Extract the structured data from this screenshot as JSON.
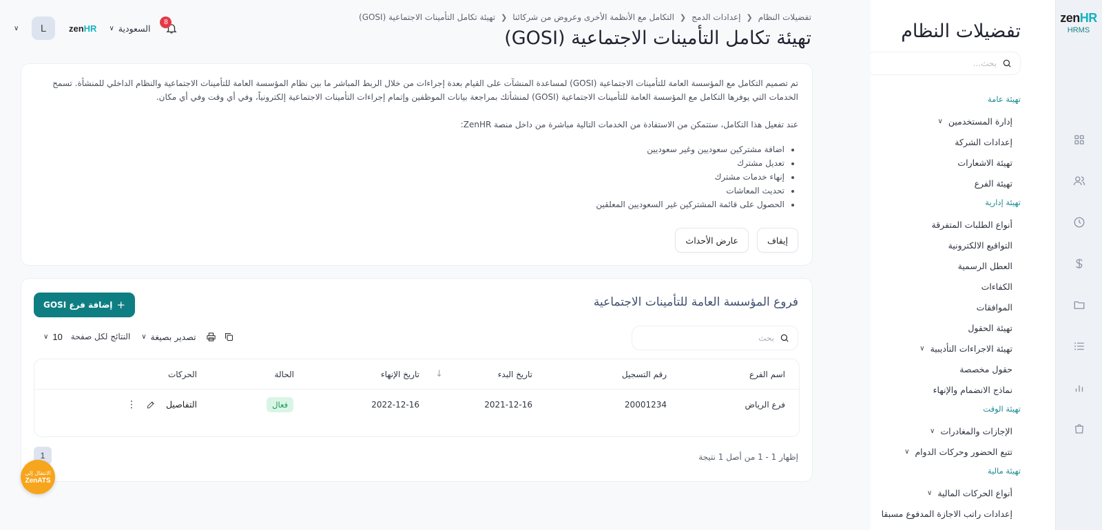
{
  "rail": {
    "brand": "zen",
    "brand_accent": "HR",
    "product": "HRMS",
    "icons": [
      "grid-icon",
      "users-icon",
      "clock-icon",
      "dollar-icon",
      "folder-icon",
      "list-icon",
      "bar-chart-icon",
      "bag-icon"
    ]
  },
  "sidebar": {
    "title": "تفضيلات النظام",
    "search_placeholder": "بحث...",
    "entries": [
      {
        "type": "section",
        "label": "تهيئة عامة"
      },
      {
        "type": "item",
        "label": "إدارة المستخدمين",
        "expandable": true
      },
      {
        "type": "item",
        "label": "إعدادات الشركة"
      },
      {
        "type": "item",
        "label": "تهيئة الاشعارات"
      },
      {
        "type": "item",
        "label": "تهيئة الفرع"
      },
      {
        "type": "section",
        "label": "تهيئة إدارية"
      },
      {
        "type": "item",
        "label": "أنواع الطلبات المتفرقة"
      },
      {
        "type": "item",
        "label": "التواقيع الالكترونية"
      },
      {
        "type": "item",
        "label": "العطل الرسمية"
      },
      {
        "type": "item",
        "label": "الكفاءات"
      },
      {
        "type": "item",
        "label": "الموافقات"
      },
      {
        "type": "item",
        "label": "تهيئة الحقول"
      },
      {
        "type": "item",
        "label": "تهيئة الاجراءات التأديبية",
        "expandable": true
      },
      {
        "type": "item",
        "label": "حقول مخصصة"
      },
      {
        "type": "item",
        "label": "نماذج الانضمام والإنهاء"
      },
      {
        "type": "section",
        "label": "تهيئة الوقت"
      },
      {
        "type": "item",
        "label": "الإجازات والمغادرات",
        "expandable": true
      },
      {
        "type": "item",
        "label": "تتبع الحضور وحركات الدوام",
        "expandable": true
      },
      {
        "type": "section",
        "label": "تهيئة مالية"
      },
      {
        "type": "item",
        "label": "أنواع الحركات المالية",
        "expandable": true
      },
      {
        "type": "item",
        "label": "إعدادات راتب الاجازة المدفوع مسبقا"
      }
    ]
  },
  "header": {
    "breadcrumb": [
      "تفضيلات النظام",
      "إعدادات الدمج",
      "التكامل مع الأنظمة الأخرى وعروض من شركائنا",
      "تهيئة تكامل التأمينات الاجتماعية (GOSI)"
    ],
    "title": "تهيئة تكامل التأمينات الاجتماعية (GOSI)",
    "notification_count": "8",
    "country": "السعودية",
    "logo_brand": "zen",
    "logo_accent": "HR",
    "avatar_initial": "L"
  },
  "intro": {
    "paragraph": "تم تصميم التكامل مع المؤسسة العامة للتأمينات الاجتماعية (GOSI) لمساعدة المنشآت على القيام بعدة إجراءات من خلال الربط المباشر ما بين نظام المؤسسة العامة للتأمينات الاجتماعية والنظام الداخلي للمنشأة. تسمح الخدمات التي يوفرها التكامل مع المؤسسة العامة للتأمينات الاجتماعية (GOSI) لمنشأتك بمراجعة بيانات الموظفين وإتمام إجراءات التأمينات الاجتماعية إلكترونياً، وفي أي وقت وفي أي مكان.",
    "lead": "عند تفعيل هذا التكامل، ستتمكن من الاستفادة من الخدمات التالية مباشرة من داخل منصة ZenHR:",
    "services": [
      "اضافة مشتركين سعوديين وغير سعوديين",
      "تعديل مشترك",
      "إنهاء خدمات مشترك",
      "تحديث المعاشات",
      "الحصول على قائمة المشتركين غير السعوديين المعلقين"
    ],
    "stop_label": "إيقاف",
    "events_label": "عارض الأحداث"
  },
  "branches": {
    "title": "فروع المؤسسة العامة للتأمينات الاجتماعية",
    "add_label": "إضافة فرع GOSI",
    "search_placeholder": "بحث",
    "export_label": "تصدير بصيغة",
    "per_page_label": "النتائج لكل صفحة",
    "per_page_value": "10",
    "columns": {
      "name": "اسم الفرع",
      "reg": "رقم التسجيل",
      "start": "تاريخ البدء",
      "end": "تاريخ الإنهاء",
      "status": "الحالة",
      "actions": "الحركات"
    },
    "rows": [
      {
        "name": "فرع الرياض",
        "reg": "20001234",
        "start": "2021-12-16",
        "end": "2022-12-16",
        "status": "فعال",
        "details": "التفاصيل"
      }
    ],
    "showing": "إظهار 1 - 1 من أصل 1 نتيجة",
    "page": "1"
  },
  "zenats": {
    "line1": "الانتقال إلى",
    "line2": "ZenATS"
  },
  "colors": {
    "accent": "#0f7e82",
    "brand_teal": "#12b2bf",
    "badge_red": "#e53945",
    "status_green_bg": "#d9f5e6",
    "status_green_text": "#1f9a5c",
    "zenats_orange": "#f7a51c"
  }
}
